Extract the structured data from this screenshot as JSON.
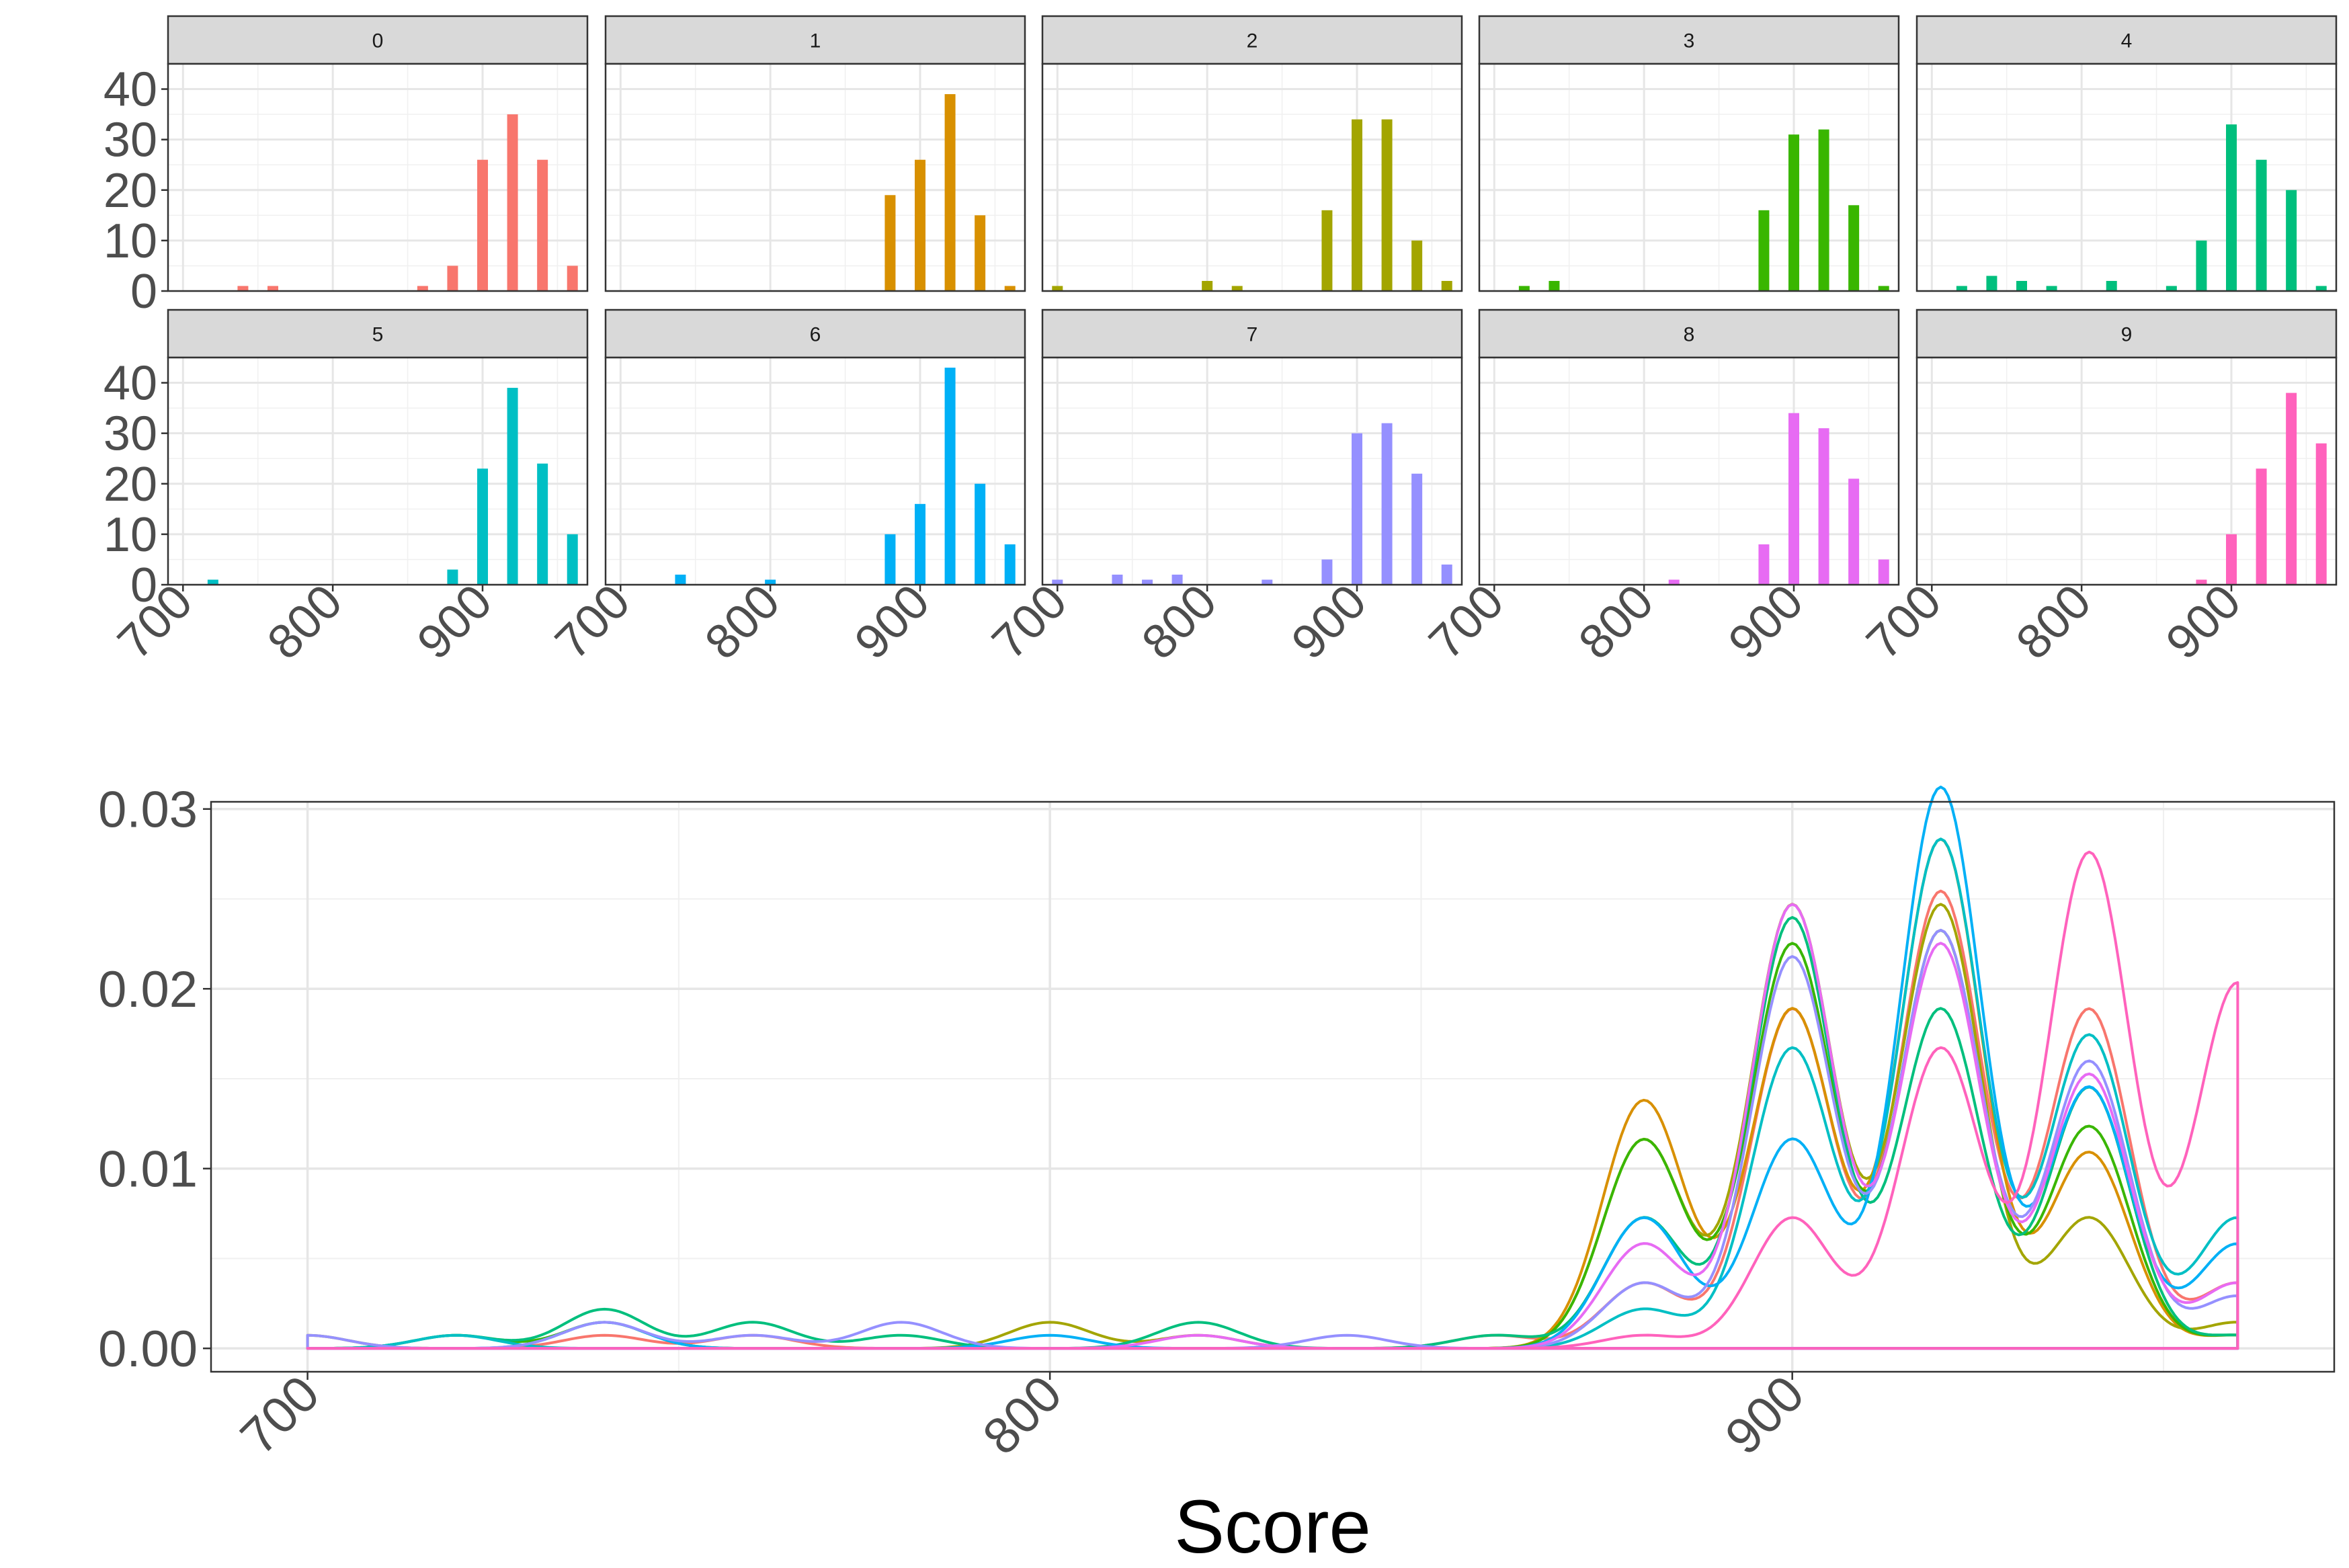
{
  "chart_data": [
    {
      "type": "bar",
      "description_role": "facetted histogram",
      "panels": [
        "0",
        "1",
        "2",
        "3",
        "4",
        "5",
        "6",
        "7",
        "8",
        "9"
      ],
      "x": [
        700,
        720,
        740,
        760,
        780,
        800,
        820,
        840,
        860,
        880,
        900,
        920,
        940,
        960
      ],
      "xlim": [
        690,
        970
      ],
      "ylim": [
        0,
        45
      ],
      "x_ticks": [
        700,
        800,
        900
      ],
      "y_ticks": [
        0,
        10,
        20,
        30,
        40
      ],
      "grid": true,
      "series": [
        {
          "name": "0",
          "color": "#F8766D",
          "values": [
            0,
            0,
            1,
            1,
            0,
            0,
            0,
            0,
            1,
            5,
            26,
            35,
            26,
            5
          ]
        },
        {
          "name": "1",
          "color": "#D89000",
          "values": [
            0,
            0,
            0,
            0,
            0,
            0,
            0,
            0,
            0,
            19,
            26,
            39,
            15,
            1
          ]
        },
        {
          "name": "2",
          "color": "#A3A500",
          "values": [
            1,
            0,
            0,
            0,
            0,
            2,
            1,
            0,
            0,
            16,
            34,
            34,
            10,
            2
          ]
        },
        {
          "name": "3",
          "color": "#39B600",
          "values": [
            0,
            1,
            2,
            0,
            0,
            0,
            0,
            0,
            0,
            16,
            31,
            32,
            17,
            1
          ]
        },
        {
          "name": "4",
          "color": "#00BF7D",
          "values": [
            0,
            1,
            3,
            2,
            1,
            0,
            2,
            0,
            1,
            10,
            33,
            26,
            20,
            1
          ]
        },
        {
          "name": "5",
          "color": "#00BFC4",
          "values": [
            0,
            1,
            0,
            0,
            0,
            0,
            0,
            0,
            0,
            3,
            23,
            39,
            24,
            10
          ]
        },
        {
          "name": "6",
          "color": "#00B0F6",
          "values": [
            0,
            0,
            2,
            0,
            0,
            1,
            0,
            0,
            0,
            10,
            16,
            43,
            20,
            8
          ]
        },
        {
          "name": "7",
          "color": "#9590FF",
          "values": [
            1,
            0,
            2,
            1,
            2,
            0,
            0,
            1,
            0,
            5,
            30,
            32,
            22,
            4
          ]
        },
        {
          "name": "8",
          "color": "#E76BF3",
          "values": [
            0,
            0,
            0,
            0,
            0,
            0,
            1,
            0,
            0,
            8,
            34,
            31,
            21,
            5
          ]
        },
        {
          "name": "9",
          "color": "#FF62BC",
          "values": [
            0,
            0,
            0,
            0,
            0,
            0,
            0,
            0,
            0,
            1,
            10,
            23,
            38,
            28
          ]
        }
      ]
    },
    {
      "type": "line",
      "description_role": "density",
      "xlabel": "Score",
      "xlim": [
        687,
        973
      ],
      "ylim": [
        -0.0013,
        0.0304
      ],
      "x_ticks": [
        700,
        800,
        900
      ],
      "y_ticks": [
        0.0,
        0.01,
        0.02,
        0.03
      ],
      "y_tick_labels": [
        "0.00",
        "0.01",
        "0.02",
        "0.03"
      ],
      "grid": true,
      "x_range": [
        700,
        960
      ],
      "bandwidth": 5.5,
      "series_colors": [
        "#F8766D",
        "#D89000",
        "#A3A500",
        "#39B600",
        "#00BF7D",
        "#00BFC4",
        "#00B0F6",
        "#9590FF",
        "#E76BF3",
        "#FF62BC"
      ]
    }
  ]
}
